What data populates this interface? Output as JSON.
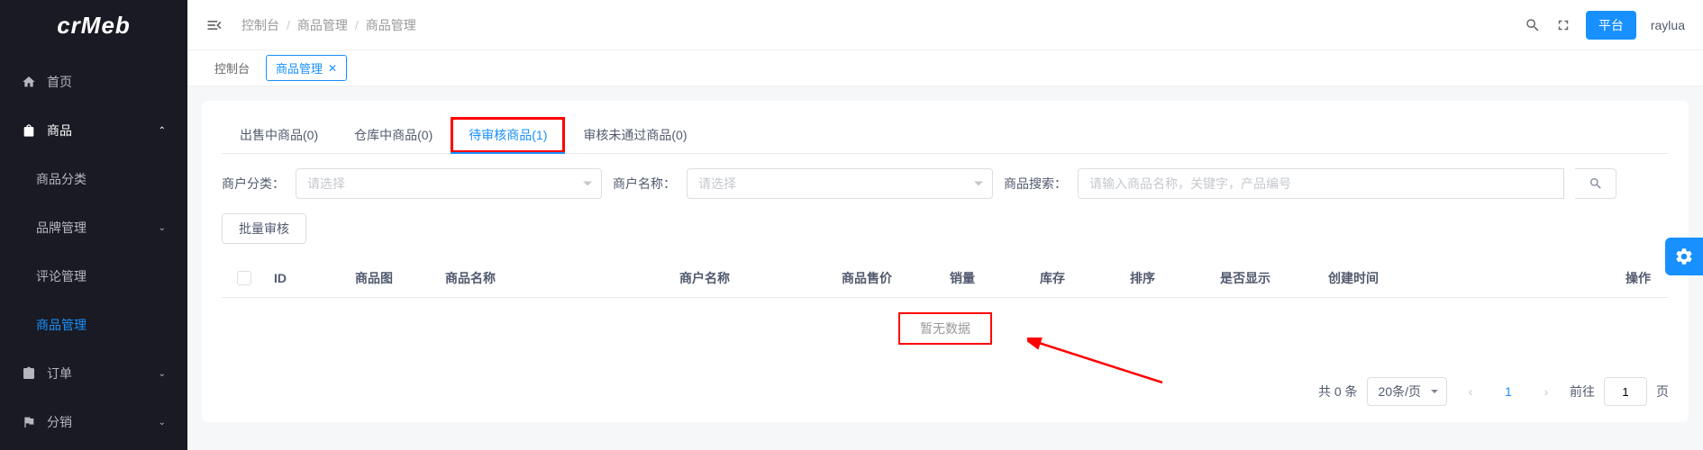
{
  "logo": "crMeb",
  "sidebar": {
    "items": [
      {
        "label": "首页",
        "icon": "home"
      },
      {
        "label": "商品",
        "icon": "bag",
        "expanded": true
      },
      {
        "label": "订单",
        "icon": "clipboard"
      },
      {
        "label": "分销",
        "icon": "flag"
      }
    ],
    "subitems": [
      {
        "label": "商品分类"
      },
      {
        "label": "品牌管理",
        "has_arrow": true
      },
      {
        "label": "评论管理"
      },
      {
        "label": "商品管理",
        "active": true
      }
    ]
  },
  "breadcrumb": [
    "控制台",
    "商品管理",
    "商品管理"
  ],
  "header": {
    "platform_label": "平台",
    "username": "raylua"
  },
  "tabs": [
    {
      "label": "控制台"
    },
    {
      "label": "商品管理",
      "active": true,
      "closable": true
    }
  ],
  "inner_tabs": [
    {
      "label": "出售中商品(0)"
    },
    {
      "label": "仓库中商品(0)"
    },
    {
      "label": "待审核商品(1)",
      "active": true,
      "highlighted": true
    },
    {
      "label": "审核未通过商品(0)"
    }
  ],
  "filters": {
    "category_label": "商户分类：",
    "category_placeholder": "请选择",
    "name_label": "商户名称：",
    "name_placeholder": "请选择",
    "search_label": "商品搜索：",
    "search_placeholder": "请输入商品名称，关键字，产品编号"
  },
  "batch_button": "批量审核",
  "columns": [
    "ID",
    "商品图",
    "商品名称",
    "商户名称",
    "商品售价",
    "销量",
    "库存",
    "排序",
    "是否显示",
    "创建时间",
    "操作"
  ],
  "empty_text": "暂无数据",
  "pagination": {
    "total_prefix": "共",
    "total_count": "0",
    "total_suffix": "条",
    "page_size": "20条/页",
    "current_page": "1",
    "goto_prefix": "前往",
    "goto_value": "1",
    "goto_suffix": "页"
  }
}
